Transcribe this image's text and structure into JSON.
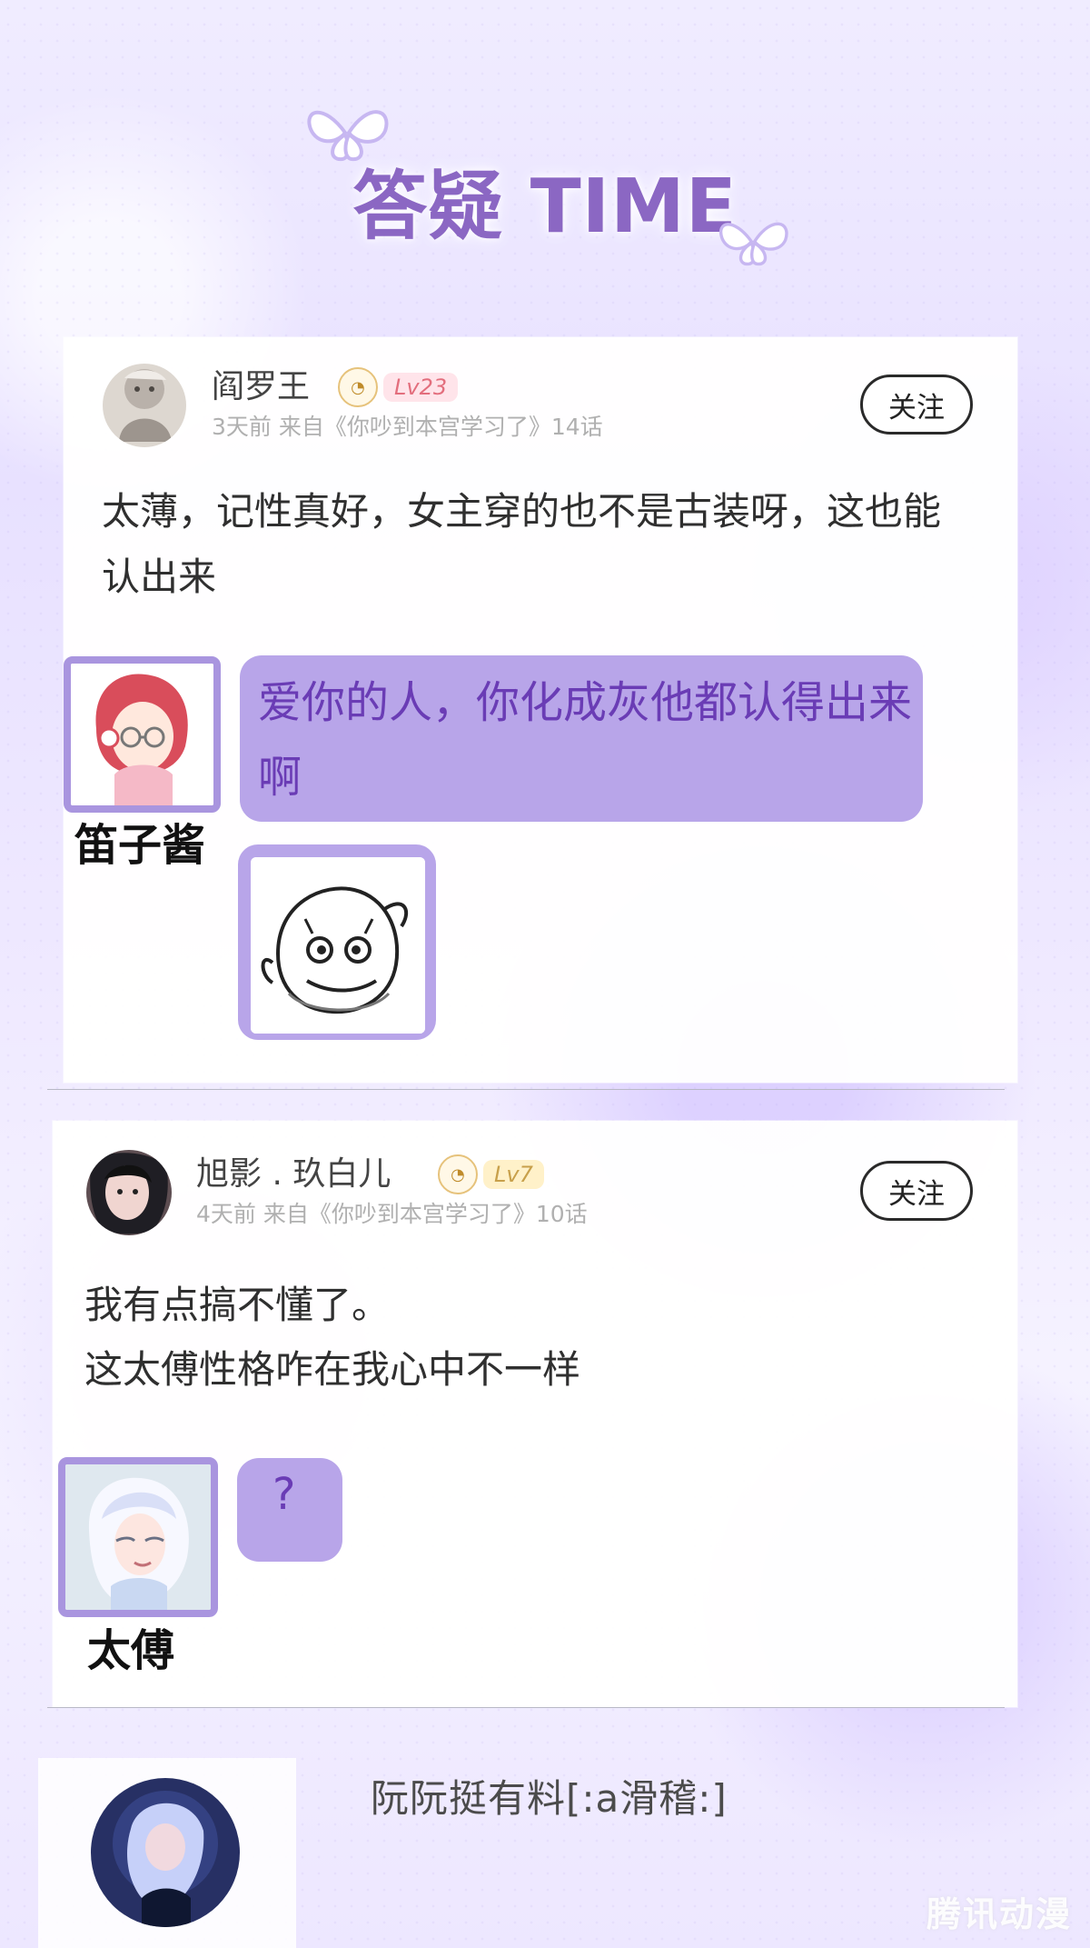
{
  "header": {
    "title": "答疑 TIME"
  },
  "posts": [
    {
      "username": "阎罗王",
      "level": "Lv23",
      "meta": "3天前  来自《你吵到本宫学习了》14话",
      "follow_label": "关注",
      "comment": "太薄，记性真好，女主穿的也不是古装呀，这也能认出来",
      "reply_character": "笛子酱",
      "reply_text": "爱你的人，你化成灰他都认得出来啊"
    },
    {
      "username": "旭影 . 玖白儿",
      "level": "Lv7",
      "meta": "4天前  来自《你吵到本宫学习了》10话",
      "follow_label": "关注",
      "comment_lines": [
        "我有点搞不懂了。",
        "这太傅性格咋在我心中不一样"
      ],
      "reply_character": "太傅",
      "reply_text": "?"
    }
  ],
  "bottom_preview": {
    "username": "阮阮挺有料[:a滑稽:]"
  },
  "watermark": {
    "label": "腾讯动漫"
  },
  "colors": {
    "bubble": "#b8a5e9",
    "bubble_text": "#6a3cb5",
    "title": "#8b67c3",
    "card": "#ffffff",
    "divider": "#b8b8c6"
  },
  "icons": [
    "butterfly-icon",
    "level-badge-icon",
    "avatar",
    "sticker-icon"
  ]
}
